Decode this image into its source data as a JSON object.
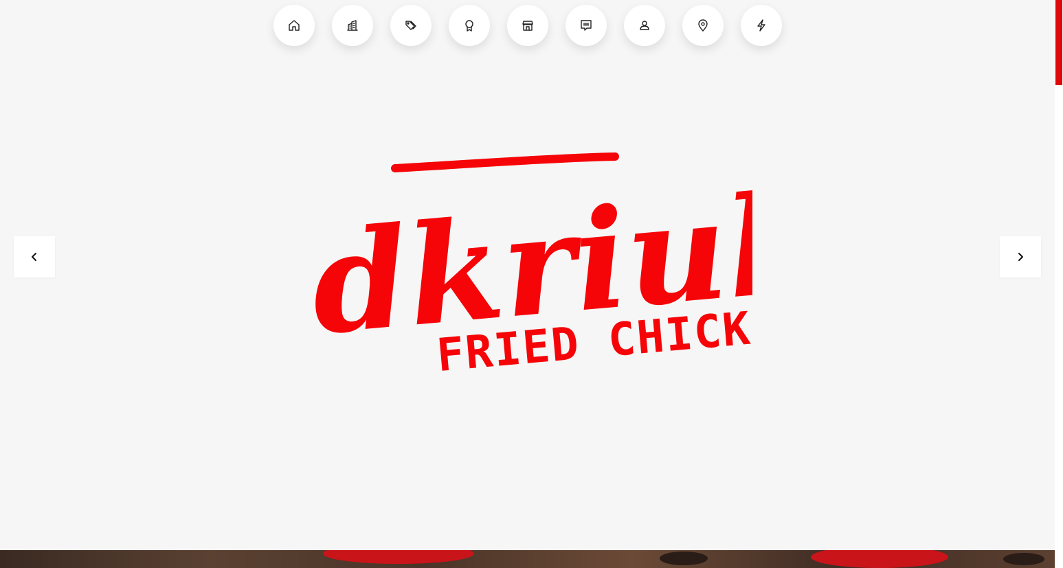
{
  "nav": {
    "items": [
      {
        "icon": "home-icon"
      },
      {
        "icon": "building-icon"
      },
      {
        "icon": "tags-icon"
      },
      {
        "icon": "award-icon"
      },
      {
        "icon": "store-icon"
      },
      {
        "icon": "quote-icon"
      },
      {
        "icon": "user-icon"
      },
      {
        "icon": "map-pin-icon"
      },
      {
        "icon": "lightning-icon"
      }
    ]
  },
  "slider": {
    "prev_icon": "chevron-left-icon",
    "next_icon": "chevron-right-icon"
  },
  "logo": {
    "script_text": "dkriuk",
    "subtitle": "FRIED CHICKEN",
    "color": "#f50508"
  },
  "theme": {
    "accent": "#e0070a",
    "background": "#f6f6f6"
  }
}
